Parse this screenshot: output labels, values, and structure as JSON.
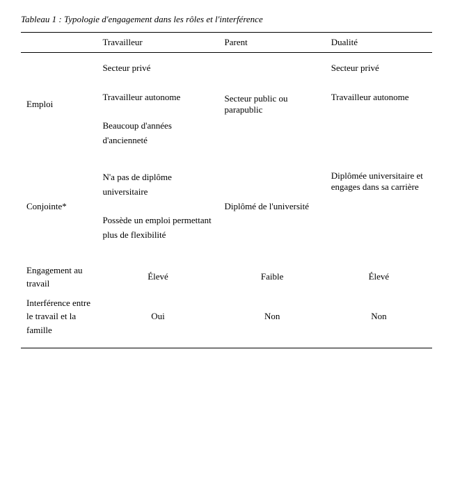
{
  "table": {
    "title": "Tableau 1 : Typologie d'engagement dans les rôles et l'interférence",
    "columns": [
      "",
      "Travailleur",
      "Parent",
      "Dualité"
    ],
    "rows": {
      "emploi": {
        "label": "Emploi",
        "travailleur": [
          "Secteur privé",
          "Travailleur autonome",
          "Beaucoup d'années d'ancienneté"
        ],
        "parent": [
          "Secteur public ou parapublic"
        ],
        "dualite": [
          "Secteur privé",
          "Travailleur autonome"
        ]
      },
      "conjointe": {
        "label": "Conjointe*",
        "travailleur": [
          "N'a pas de diplôme universitaire",
          "Possède un emploi permettant plus de flexibilité"
        ],
        "parent": [
          "Diplômé de l'université"
        ],
        "dualite": [
          "Diplômée universitaire et engages dans sa carrière"
        ]
      },
      "engagement": {
        "label": "Engagement au travail",
        "travailleur": "Élevé",
        "parent": "Faible",
        "dualite": "Élevé"
      },
      "interference": {
        "label": "Interférence entre le travail et la famille",
        "travailleur": "Oui",
        "parent": "Non",
        "dualite": "Non"
      }
    }
  }
}
